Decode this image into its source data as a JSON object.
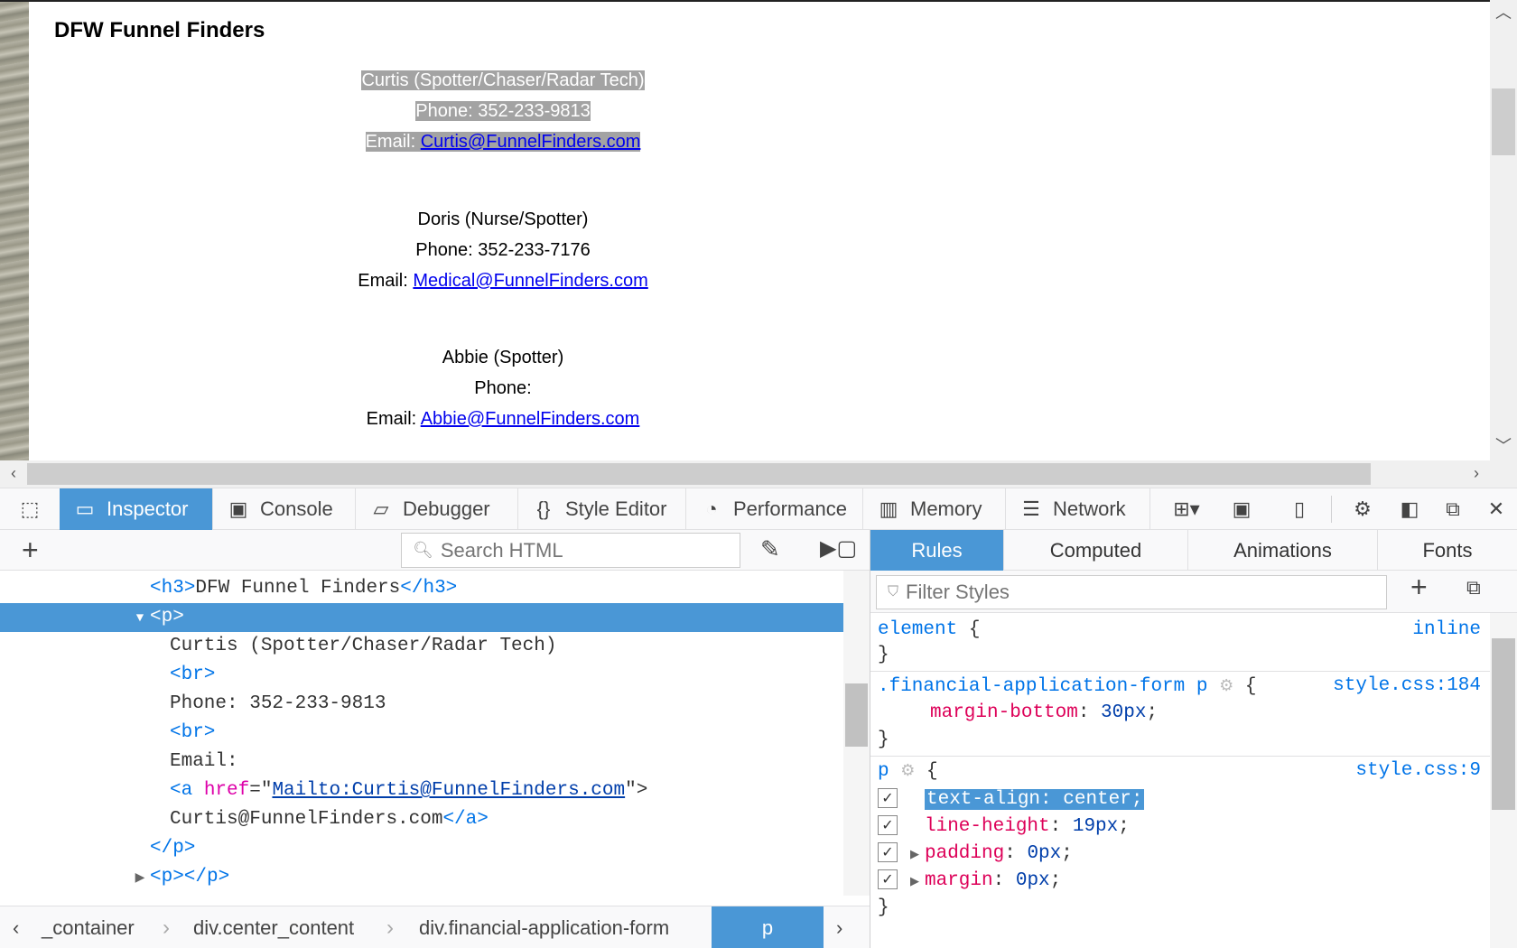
{
  "page": {
    "title": "DFW Funnel Finders",
    "contacts": [
      {
        "name_line": "Curtis (Spotter/Chaser/Radar Tech)",
        "phone_line": "Phone: 352-233-9813",
        "email_prefix": "Email: ",
        "email": "Curtis@FunnelFinders.com"
      },
      {
        "name_line": "Doris (Nurse/Spotter)",
        "phone_line": "Phone: 352-233-7176",
        "email_prefix": "Email: ",
        "email": "Medical@FunnelFinders.com"
      },
      {
        "name_line": "Abbie (Spotter)",
        "phone_line": "Phone:",
        "email_prefix": "Email: ",
        "email": "Abbie@FunnelFinders.com"
      }
    ]
  },
  "toolbar": {
    "tabs": [
      "Inspector",
      "Console",
      "Debugger",
      "Style Editor",
      "Performance",
      "Memory",
      "Network"
    ],
    "active": "Inspector"
  },
  "markup": {
    "search_placeholder": "Search HTML",
    "lines": {
      "h3_open": "<h3>",
      "h3_text": "DFW Funnel Finders",
      "h3_close": "</h3>",
      "p_open": "<p>",
      "text1": "Curtis (Spotter/Chaser/Radar Tech)",
      "br": "<br>",
      "text2": "Phone: 352-233-9813",
      "text3": "Email:",
      "a_open_start": "<a ",
      "a_attr": "href",
      "a_eq": "=\"",
      "a_href": "Mailto:Curtis@FunnelFinders.com",
      "a_open_end": "\">",
      "a_text": "Curtis@FunnelFinders.com",
      "a_close": "</a>",
      "p_close": "</p>",
      "p_collapsed": "<p></p>"
    },
    "breadcrumbs": [
      "_container",
      "div.center_content",
      "div.financial-application-form",
      "p"
    ]
  },
  "rules": {
    "tabs": [
      "Rules",
      "Computed",
      "Animations",
      "Fonts"
    ],
    "active_tab": "Rules",
    "filter_placeholder": "Filter Styles",
    "element": {
      "selector": "element",
      "open": " {",
      "close": "}",
      "source": "inline"
    },
    "rule1": {
      "selector": ".financial-application-form p",
      "open": " {",
      "source": "style.css:184",
      "prop": "margin-bottom",
      "value": "30px",
      "close": "}"
    },
    "rule2": {
      "selector": "p",
      "open": " {",
      "source": "style.css:9",
      "decls": [
        {
          "prop": "text-align",
          "value": "center",
          "highlight": true
        },
        {
          "prop": "line-height",
          "value": "19px"
        },
        {
          "prop": "padding",
          "value": "0px"
        },
        {
          "prop": "margin",
          "value": "0px"
        }
      ],
      "close": "}"
    }
  }
}
